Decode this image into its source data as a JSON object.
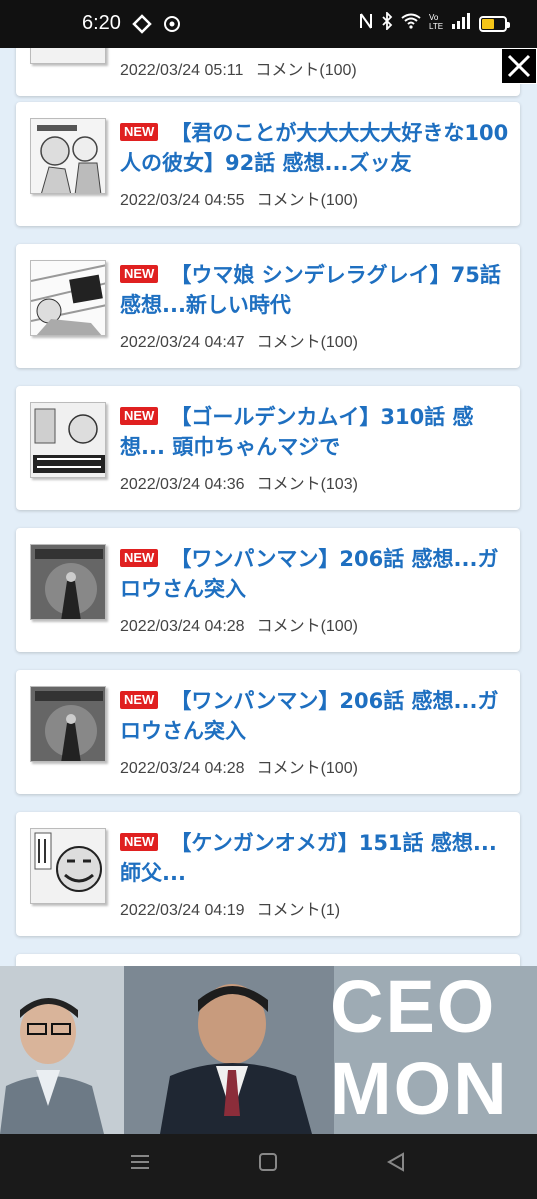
{
  "status": {
    "time": "6:20"
  },
  "articles": [
    {
      "title": "",
      "date": "2022/03/24 05:11",
      "comments": "コメント(100)"
    },
    {
      "badge": "NEW",
      "title": "【君のことが大大大大大好きな100人の彼女】92話 感想...ズッ友",
      "date": "2022/03/24 04:55",
      "comments": "コメント(100)"
    },
    {
      "badge": "NEW",
      "title": "【ウマ娘 シンデレラグレイ】75話 感想...新しい時代",
      "date": "2022/03/24 04:47",
      "comments": "コメント(100)"
    },
    {
      "badge": "NEW",
      "title": "【ゴールデンカムイ】310話 感想... 頭巾ちゃんマジで",
      "date": "2022/03/24 04:36",
      "comments": "コメント(103)"
    },
    {
      "badge": "NEW",
      "title": "【ワンパンマン】206話 感想...ガロウさん突入",
      "date": "2022/03/24 04:28",
      "comments": "コメント(100)"
    },
    {
      "badge": "NEW",
      "title": "【ワンパンマン】206話 感想...ガロウさん突入",
      "date": "2022/03/24 04:28",
      "comments": "コメント(100)"
    },
    {
      "badge": "NEW",
      "title": "【ケンガンオメガ】151話 感想... 師父...",
      "date": "2022/03/24 04:19",
      "comments": "コメント(1)"
    }
  ],
  "ad": {
    "text_line1": "CEO",
    "text_line2": "MON"
  },
  "close_label": "✕"
}
